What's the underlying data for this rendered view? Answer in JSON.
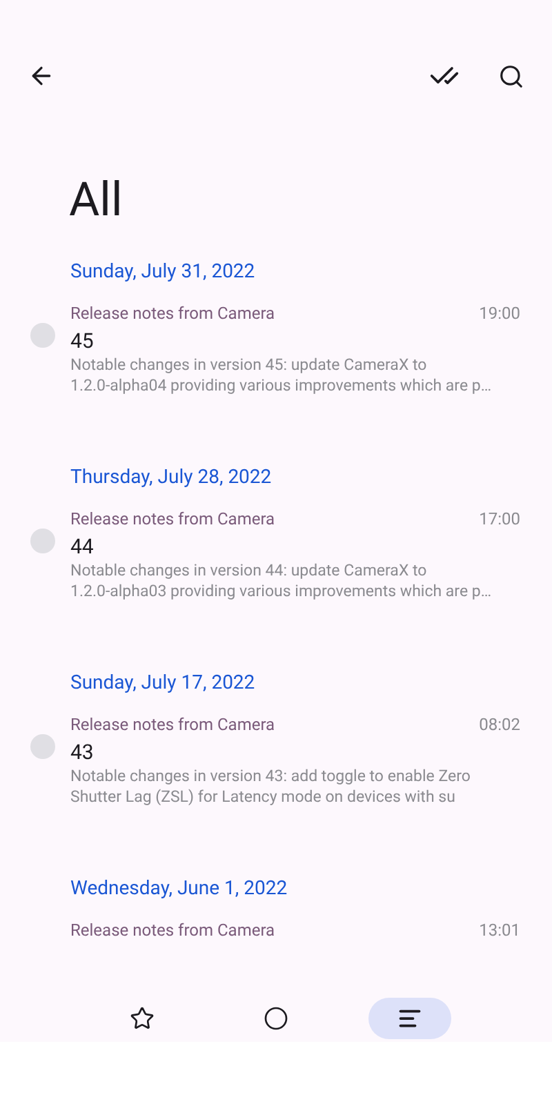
{
  "title": "All",
  "groups": [
    {
      "date": "Sunday, July 31, 2022",
      "items": [
        {
          "sender": "Release notes from Camera",
          "time": "19:00",
          "title": "45",
          "body_lines": [
            "Notable changes in version 45: update CameraX to",
            "1.2.0-alpha04 providing various improvements which are p…"
          ]
        }
      ]
    },
    {
      "date": "Thursday, July 28, 2022",
      "items": [
        {
          "sender": "Release notes from Camera",
          "time": "17:00",
          "title": "44",
          "body_lines": [
            "Notable changes in version 44: update CameraX to",
            "1.2.0-alpha03 providing various improvements which are p…"
          ]
        }
      ]
    },
    {
      "date": "Sunday, July 17, 2022",
      "items": [
        {
          "sender": "Release notes from Camera",
          "time": "08:02",
          "title": "43",
          "body_lines": [
            "Notable changes in version 43: add toggle to enable Zero",
            "Shutter Lag (ZSL) for Latency mode on devices with su"
          ]
        }
      ]
    },
    {
      "date": "Wednesday, June 1, 2022",
      "items": [
        {
          "sender": "Release notes from Camera",
          "time": "13:01"
        }
      ]
    }
  ],
  "nav": [
    {
      "kind": "star",
      "selected": false
    },
    {
      "kind": "circle",
      "selected": false
    },
    {
      "kind": "list",
      "selected": true
    }
  ]
}
